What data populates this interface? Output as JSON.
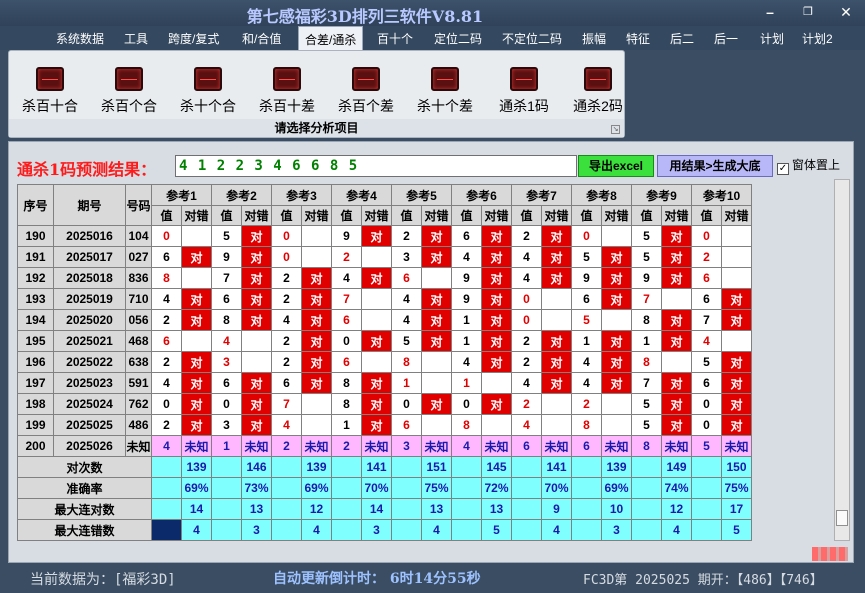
{
  "window": {
    "title": "第七感福彩3D排列三软件V8.81",
    "min_icon": "minimize-icon",
    "max_icon": "restore-icon",
    "close_icon": "close-icon"
  },
  "menu": [
    "系统数据",
    "工具",
    "跨度/复式",
    "和/合值",
    "合差/通杀",
    "百十个",
    "定位二码",
    "不定位二码",
    "振幅",
    "特征",
    "后二",
    "后一",
    "计划",
    "计划2"
  ],
  "menu_active_index": 4,
  "ribbon": {
    "buttons": [
      "杀百十合",
      "杀百个合",
      "杀十个合",
      "杀百十差",
      "杀百个差",
      "杀十个差",
      "通杀1码",
      "通杀2码"
    ],
    "icon": "chart-icon",
    "caption": "请选择分析项目"
  },
  "prediction": {
    "label": "通杀1码预测结果：",
    "value": "4 1 2 2 3 4 6 6 8 5",
    "export_button": "导出excel",
    "generate_button": "用结果>生成大底",
    "topmost_label": "窗体置上",
    "topmost_checked": "✓"
  },
  "table": {
    "col_seq": "序号",
    "col_period": "期号",
    "col_number": "号码",
    "refs": [
      "参考1",
      "参考2",
      "参考3",
      "参考4",
      "参考5",
      "参考6",
      "参考7",
      "参考8",
      "参考9",
      "参考10"
    ],
    "sub_value": "值",
    "sub_result": "对错",
    "hit_text": "对",
    "rows": [
      {
        "seq": "190",
        "period": "2025016",
        "num": "104",
        "vals": [
          "0",
          "5",
          "0",
          "9",
          "2",
          "6",
          "2",
          "0",
          "5",
          "0"
        ],
        "red": [
          1,
          0,
          1,
          0,
          0,
          0,
          0,
          1,
          0,
          1
        ],
        "hit": [
          0,
          1,
          0,
          1,
          1,
          1,
          1,
          0,
          1,
          0
        ]
      },
      {
        "seq": "191",
        "period": "2025017",
        "num": "027",
        "vals": [
          "6",
          "9",
          "0",
          "2",
          "3",
          "4",
          "4",
          "5",
          "5",
          "2"
        ],
        "red": [
          0,
          0,
          1,
          1,
          0,
          0,
          0,
          0,
          0,
          1
        ],
        "hit": [
          1,
          1,
          0,
          0,
          1,
          1,
          1,
          1,
          1,
          0
        ]
      },
      {
        "seq": "192",
        "period": "2025018",
        "num": "836",
        "vals": [
          "8",
          "7",
          "2",
          "4",
          "6",
          "9",
          "4",
          "9",
          "9",
          "6"
        ],
        "red": [
          1,
          0,
          0,
          0,
          1,
          0,
          0,
          0,
          0,
          1
        ],
        "hit": [
          0,
          1,
          1,
          1,
          0,
          1,
          1,
          1,
          1,
          0
        ]
      },
      {
        "seq": "193",
        "period": "2025019",
        "num": "710",
        "vals": [
          "4",
          "6",
          "2",
          "7",
          "4",
          "9",
          "0",
          "6",
          "7",
          "6"
        ],
        "red": [
          0,
          0,
          0,
          1,
          0,
          0,
          1,
          0,
          1,
          0
        ],
        "hit": [
          1,
          1,
          1,
          0,
          1,
          1,
          0,
          1,
          0,
          1
        ]
      },
      {
        "seq": "194",
        "period": "2025020",
        "num": "056",
        "vals": [
          "2",
          "8",
          "4",
          "6",
          "4",
          "1",
          "0",
          "5",
          "8",
          "7"
        ],
        "red": [
          0,
          0,
          0,
          1,
          0,
          0,
          1,
          1,
          0,
          0
        ],
        "hit": [
          1,
          1,
          1,
          0,
          1,
          1,
          0,
          0,
          1,
          1
        ]
      },
      {
        "seq": "195",
        "period": "2025021",
        "num": "468",
        "vals": [
          "6",
          "4",
          "2",
          "0",
          "5",
          "1",
          "2",
          "1",
          "1",
          "4"
        ],
        "red": [
          1,
          1,
          0,
          0,
          0,
          0,
          0,
          0,
          0,
          1
        ],
        "hit": [
          0,
          0,
          1,
          1,
          1,
          1,
          1,
          1,
          1,
          0
        ]
      },
      {
        "seq": "196",
        "period": "2025022",
        "num": "638",
        "vals": [
          "2",
          "3",
          "2",
          "6",
          "8",
          "4",
          "2",
          "4",
          "8",
          "5"
        ],
        "red": [
          0,
          1,
          0,
          1,
          1,
          0,
          0,
          0,
          1,
          0
        ],
        "hit": [
          1,
          0,
          1,
          0,
          0,
          1,
          1,
          1,
          0,
          1
        ]
      },
      {
        "seq": "197",
        "period": "2025023",
        "num": "591",
        "vals": [
          "4",
          "6",
          "6",
          "8",
          "1",
          "1",
          "4",
          "4",
          "7",
          "6"
        ],
        "red": [
          0,
          0,
          0,
          0,
          1,
          1,
          0,
          0,
          0,
          0
        ],
        "hit": [
          1,
          1,
          1,
          1,
          0,
          0,
          1,
          1,
          1,
          1
        ]
      },
      {
        "seq": "198",
        "period": "2025024",
        "num": "762",
        "vals": [
          "0",
          "0",
          "7",
          "8",
          "0",
          "0",
          "2",
          "2",
          "5",
          "0"
        ],
        "red": [
          0,
          0,
          1,
          0,
          0,
          0,
          1,
          1,
          0,
          0
        ],
        "hit": [
          1,
          1,
          0,
          1,
          1,
          1,
          0,
          0,
          1,
          1
        ]
      },
      {
        "seq": "199",
        "period": "2025025",
        "num": "486",
        "vals": [
          "2",
          "3",
          "4",
          "1",
          "6",
          "8",
          "4",
          "8",
          "5",
          "0"
        ],
        "red": [
          0,
          0,
          1,
          0,
          1,
          1,
          1,
          1,
          0,
          0
        ],
        "hit": [
          1,
          1,
          0,
          1,
          0,
          0,
          0,
          0,
          1,
          1
        ]
      }
    ],
    "pending": {
      "seq": "200",
      "period": "2025026",
      "num": "未知",
      "vals": [
        "4",
        "1",
        "2",
        "2",
        "3",
        "4",
        "6",
        "6",
        "8",
        "5"
      ],
      "result": "未知"
    },
    "stats": [
      {
        "label": "对次数",
        "vals": [
          "139",
          "146",
          "139",
          "141",
          "151",
          "145",
          "141",
          "139",
          "149",
          "150"
        ]
      },
      {
        "label": "准确率",
        "vals": [
          "69%",
          "73%",
          "69%",
          "70%",
          "75%",
          "72%",
          "70%",
          "69%",
          "74%",
          "75%"
        ]
      },
      {
        "label": "最大连对数",
        "vals": [
          "14",
          "13",
          "12",
          "14",
          "13",
          "13",
          "9",
          "10",
          "12",
          "17"
        ]
      },
      {
        "label": "最大连错数",
        "vals": [
          "4",
          "3",
          "4",
          "3",
          "4",
          "5",
          "4",
          "3",
          "4",
          "5"
        ]
      }
    ]
  },
  "status": {
    "current_data": "当前数据为：[福彩3D]",
    "countdown": "自动更新倒计时： 6时14分55秒",
    "draw_info": "FC3D第 2025025 期开：【486】【746】"
  }
}
